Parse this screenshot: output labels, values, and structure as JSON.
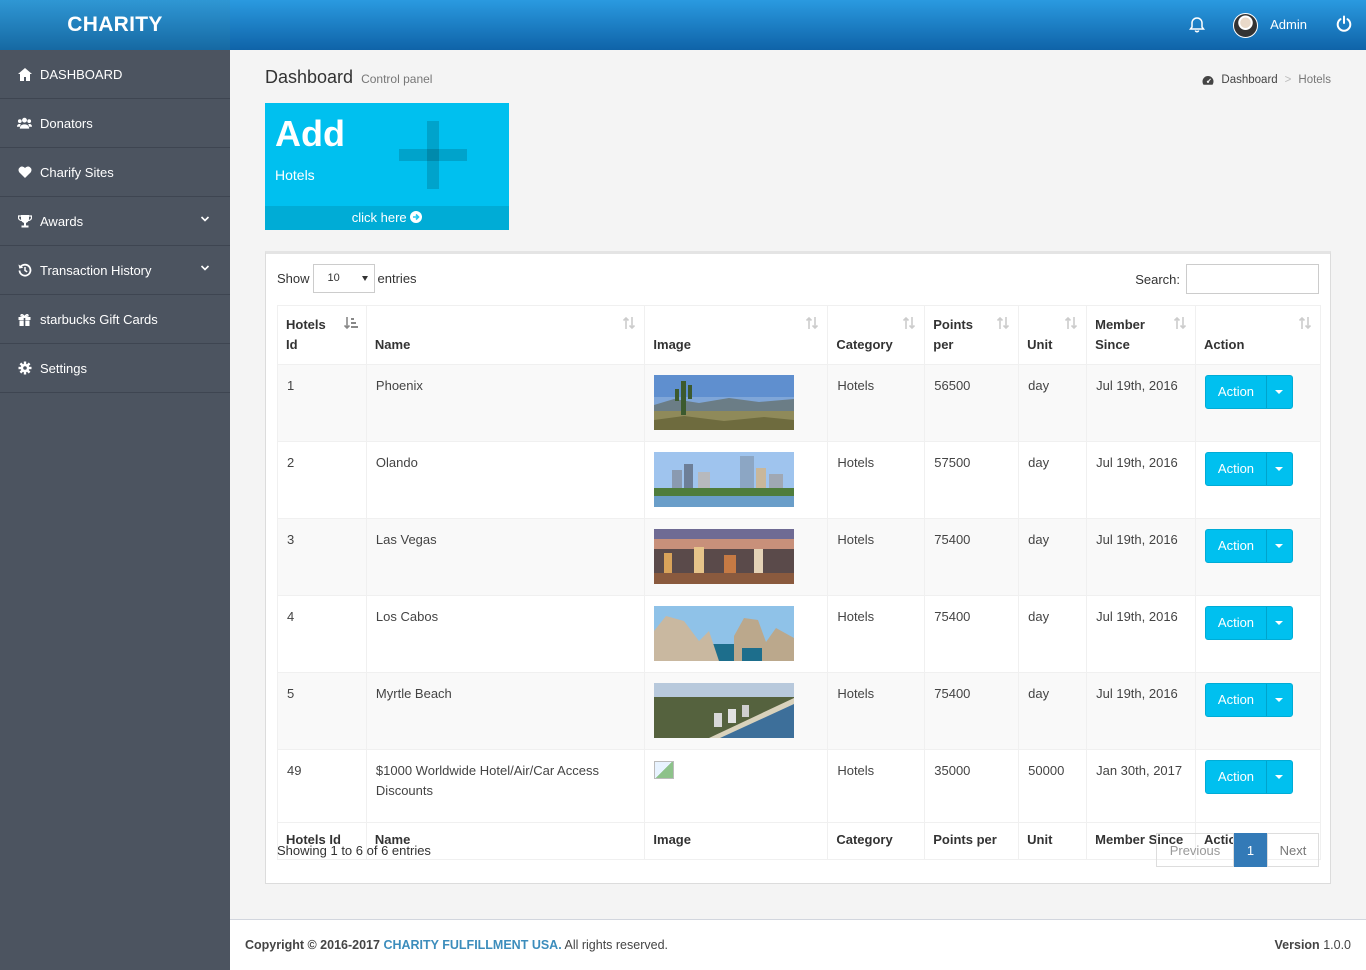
{
  "brand": "CHARITY",
  "topbar": {
    "user": "Admin"
  },
  "sidebar": {
    "items": [
      {
        "label": "DASHBOARD",
        "icon": "home-icon"
      },
      {
        "label": "Donators",
        "icon": "users-icon"
      },
      {
        "label": "Charify Sites",
        "icon": "heart-icon"
      },
      {
        "label": "Awards",
        "icon": "trophy-icon",
        "expandable": true
      },
      {
        "label": "Transaction History",
        "icon": "history-icon",
        "expandable": true
      },
      {
        "label": "starbucks Gift Cards",
        "icon": "gift-icon"
      },
      {
        "label": "Settings",
        "icon": "gear-icon"
      }
    ]
  },
  "header": {
    "title": "Dashboard",
    "subtitle": "Control panel"
  },
  "breadcrumb": {
    "home": "Dashboard",
    "current": "Hotels"
  },
  "add_box": {
    "title": "Add",
    "subtitle": "Hotels",
    "link": "click here"
  },
  "table_controls": {
    "show": "Show",
    "entries_value": "10",
    "entries": "entries",
    "search_label": "Search:"
  },
  "table": {
    "headers": {
      "id": "Hotels Id",
      "name": "Name",
      "image": "Image",
      "category": "Category",
      "points": "Points per",
      "unit": "Unit",
      "member": "Member Since",
      "action": "Action"
    },
    "rows": [
      {
        "id": "1",
        "name": "Phoenix",
        "category": "Hotels",
        "points": "56500",
        "unit": "day",
        "member": "Jul 19th, 2016",
        "action": "Action"
      },
      {
        "id": "2",
        "name": "Olando",
        "category": "Hotels",
        "points": "57500",
        "unit": "day",
        "member": "Jul 19th, 2016",
        "action": "Action"
      },
      {
        "id": "3",
        "name": "Las Vegas",
        "category": "Hotels",
        "points": "75400",
        "unit": "day",
        "member": "Jul 19th, 2016",
        "action": "Action"
      },
      {
        "id": "4",
        "name": "Los Cabos",
        "category": "Hotels",
        "points": "75400",
        "unit": "day",
        "member": "Jul 19th, 2016",
        "action": "Action"
      },
      {
        "id": "5",
        "name": "Myrtle Beach",
        "category": "Hotels",
        "points": "75400",
        "unit": "day",
        "member": "Jul 19th, 2016",
        "action": "Action"
      },
      {
        "id": "49",
        "name": "$1000 Worldwide Hotel/Air/Car Access Discounts",
        "category": "Hotels",
        "points": "35000",
        "unit": "50000",
        "member": "Jan 30th, 2017",
        "action": "Action"
      }
    ]
  },
  "table_info": "Showing 1 to 6 of 6 entries",
  "pagination": {
    "previous": "Previous",
    "current": "1",
    "next": "Next"
  },
  "footer": {
    "copyright": "Copyright © 2016-2017",
    "company": "CHARITY FULFILLMENT USA.",
    "rights": "All rights reserved.",
    "version_label": "Version",
    "version": "1.0.0"
  },
  "colors": {
    "accent": "#00c0ef",
    "sidebar": "#4c5460",
    "topbar": "#1a7ec2",
    "pager_active": "#337ab7"
  }
}
